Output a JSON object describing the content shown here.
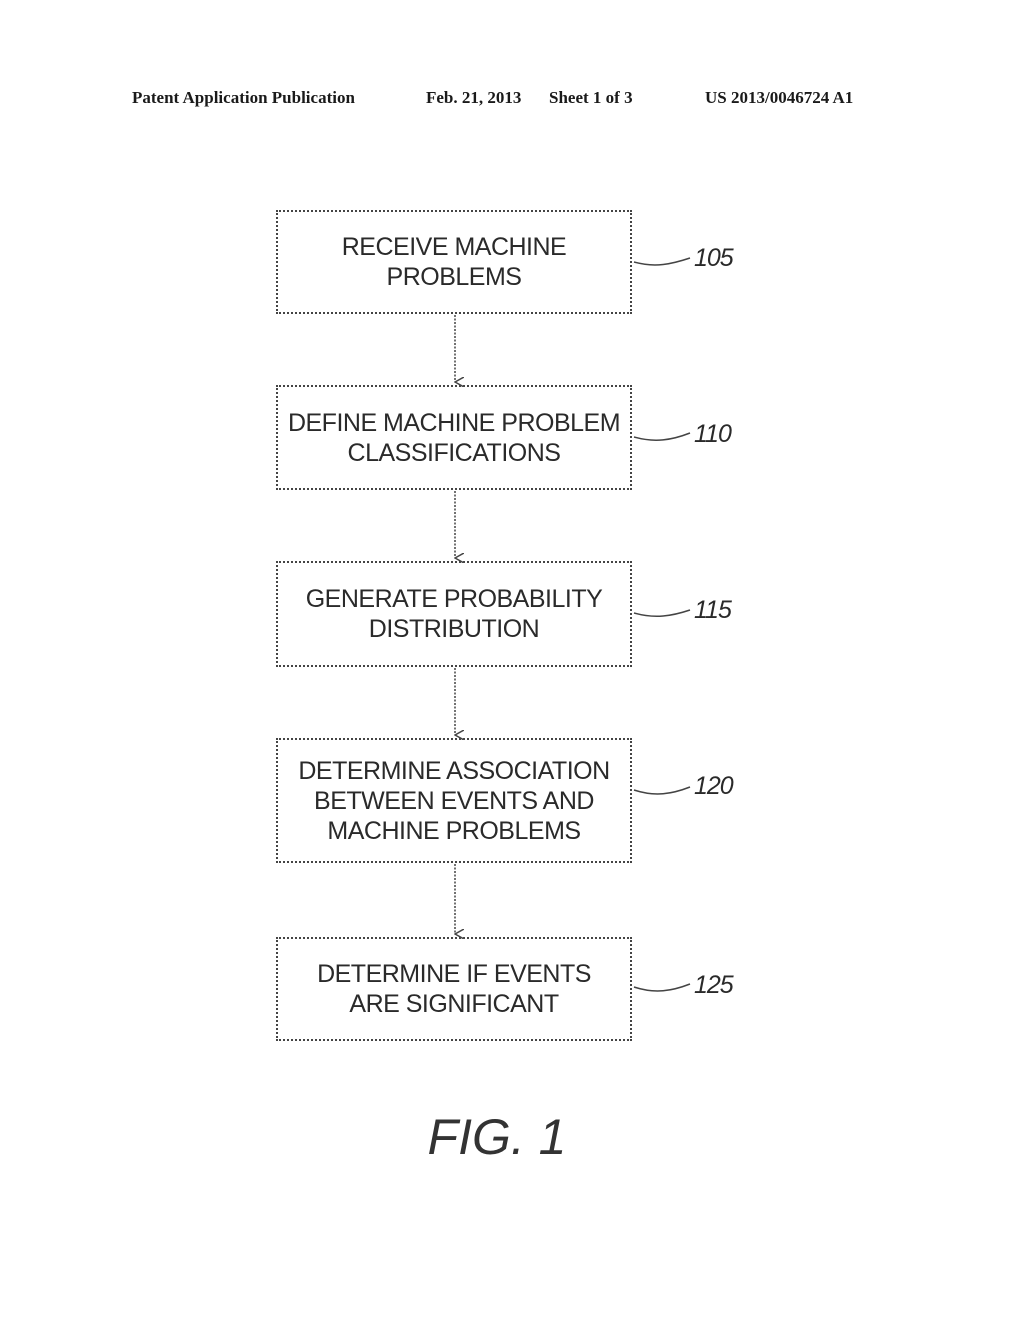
{
  "header": {
    "publication": "Patent Application Publication",
    "date": "Feb. 21, 2013",
    "sheet": "Sheet 1 of 3",
    "number": "US 2013/0046724 A1"
  },
  "flowchart": {
    "steps": [
      {
        "text": "RECEIVE MACHINE\nPROBLEMS",
        "ref": "105"
      },
      {
        "text": "DEFINE MACHINE PROBLEM\nCLASSIFICATIONS",
        "ref": "110"
      },
      {
        "text": "GENERATE PROBABILITY\nDISTRIBUTION",
        "ref": "115"
      },
      {
        "text": "DETERMINE ASSOCIATION\nBETWEEN EVENTS AND\nMACHINE PROBLEMS",
        "ref": "120"
      },
      {
        "text": "DETERMINE IF EVENTS\nARE SIGNIFICANT",
        "ref": "125"
      }
    ]
  },
  "figure_label": "FIG. 1"
}
